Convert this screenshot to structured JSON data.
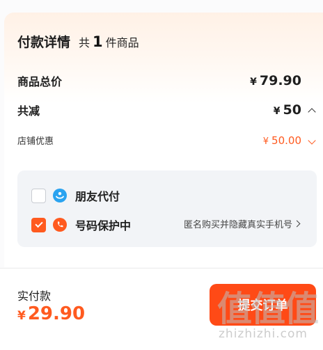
{
  "details": {
    "title": "付款详情",
    "count_prefix": "共",
    "count": "1",
    "count_suffix": "件商品",
    "total_label": "商品总价",
    "total_currency": "¥",
    "total_value": "79.90",
    "discount_label": "共减",
    "discount_currency": "¥",
    "discount_value": "50",
    "store_label": "店铺优惠",
    "store_currency": "¥",
    "store_value": "50.00"
  },
  "options": {
    "friend_pay_label": "朋友代付",
    "friend_pay_checked": false,
    "privacy_label": "号码保护中",
    "privacy_checked": true,
    "privacy_note": "匿名购买并隐藏真实手机号"
  },
  "footer": {
    "pay_label": "实付款",
    "pay_currency": "¥",
    "pay_value": "29.90",
    "submit_label": "提交订单"
  },
  "watermark": {
    "mark": "值值值",
    "url": "zhizhizhi.com"
  },
  "colors": {
    "accent": "#ff5a1f",
    "button": "#ff4a16",
    "panel_bg": "#f2f4f7",
    "friend_icon": "#2aa3f0",
    "privacy_icon": "#ff5a1f"
  }
}
